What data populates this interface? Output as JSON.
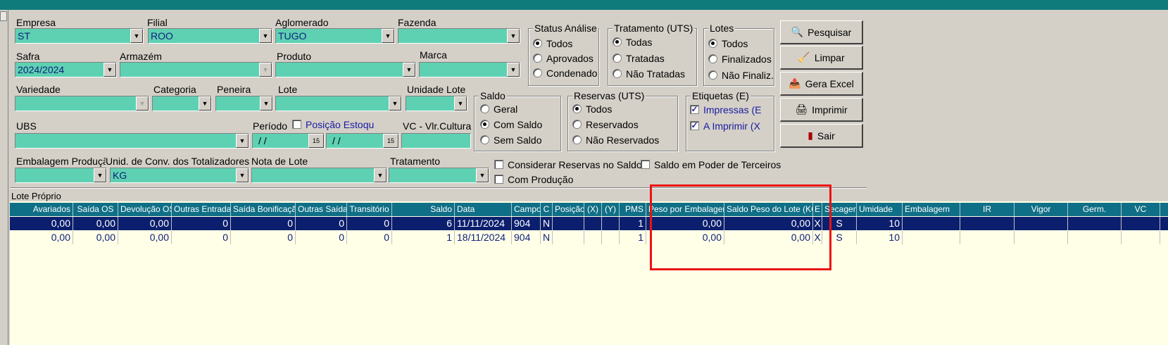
{
  "filters": {
    "empresa": {
      "label": "Empresa",
      "value": "ST"
    },
    "filial": {
      "label": "Filial",
      "value": "ROO"
    },
    "aglomerado": {
      "label": "Aglomerado",
      "value": "TUGO"
    },
    "fazenda": {
      "label": "Fazenda",
      "value": ""
    },
    "safra": {
      "label": "Safra",
      "value": "2024/2024"
    },
    "armazem": {
      "label": "Armazém",
      "value": ""
    },
    "produto": {
      "label": "Produto",
      "value": ""
    },
    "marca": {
      "label": "Marca",
      "value": ""
    },
    "variedade": {
      "label": "Variedade",
      "value": ""
    },
    "categoria": {
      "label": "Categoria",
      "value": ""
    },
    "peneira": {
      "label": "Peneira",
      "value": ""
    },
    "lote": {
      "label": "Lote",
      "value": ""
    },
    "unidade_lote": {
      "label": "Unidade Lote",
      "value": ""
    },
    "ubs": {
      "label": "UBS",
      "value": ""
    },
    "periodo": {
      "label": "Período",
      "from": " / /",
      "to": " / /"
    },
    "posicao_estoque": {
      "label": "Posição Estoqu"
    },
    "vc": {
      "label": "VC - Vlr.Cultura",
      "value": ""
    },
    "embalagem_producao": {
      "label": "Embalagem Produção",
      "value": ""
    },
    "unid_conv": {
      "label": "Unid. de Conv. dos Totalizadores",
      "value": "KG"
    },
    "nota_lote": {
      "label": "Nota de Lote",
      "value": ""
    },
    "tratamento": {
      "label": "Tratamento",
      "value": ""
    },
    "considerar_reservas": {
      "label": "Considerar Reservas no Saldo"
    },
    "saldo_terceiros": {
      "label": "Saldo em Poder de Terceiros"
    },
    "com_producao": {
      "label": "Com Produção"
    }
  },
  "groups": {
    "status_analise": {
      "title": "Status Análise",
      "options": [
        "Todos",
        "Aprovados",
        "Condenado"
      ]
    },
    "tratamento_uts": {
      "title": "Tratamento (UTS)",
      "options": [
        "Todas",
        "Tratadas",
        "Não Tratadas"
      ]
    },
    "lotes": {
      "title": "Lotes",
      "options": [
        "Todos",
        "Finalizados",
        "Não Finaliz."
      ]
    },
    "saldo": {
      "title": "Saldo",
      "options": [
        "Geral",
        "Com Saldo",
        "Sem Saldo"
      ]
    },
    "reservas_uts": {
      "title": "Reservas (UTS)",
      "options": [
        "Todos",
        "Reservados",
        "Não Reservados"
      ]
    },
    "etiquetas": {
      "title": "Etiquetas (E)",
      "options": [
        "Impressas (E",
        "A Imprimir (X"
      ]
    }
  },
  "buttons": {
    "pesquisar": "Pesquisar",
    "limpar": "Limpar",
    "gera_excel": "Gera Excel",
    "imprimir": "Imprimir",
    "sair": "Sair"
  },
  "section_label": "Lote Próprio",
  "grid": {
    "columns": [
      "Avariados",
      "Saída OS",
      "Devolução OS",
      "Outras Entradas",
      "Saída Bonificação",
      "Outras Saídas",
      "Transitório",
      "Saldo",
      "Data",
      "Campo",
      "C",
      "Posição",
      "(X)",
      "(Y)",
      "PMS",
      "Peso por Embalagem",
      "Saldo Peso do Lote (KG)",
      "E",
      "Secagem",
      "Umidade",
      "Embalagem",
      "IR",
      "Vigor",
      "Germ.",
      "VC"
    ],
    "rows": [
      [
        "0,00",
        "0,00",
        "0,00",
        "0",
        "0",
        "0",
        "0",
        "6",
        "11/11/2024",
        "904",
        "N",
        "",
        "",
        "",
        "1",
        "0,00",
        "0,00",
        "X",
        "S",
        "10",
        "",
        "",
        "",
        "",
        ""
      ],
      [
        "0,00",
        "0,00",
        "0,00",
        "0",
        "0",
        "0",
        "0",
        "1",
        "18/11/2024",
        "904",
        "N",
        "",
        "",
        "",
        "1",
        "0,00",
        "0,00",
        "X",
        "S",
        "10",
        "",
        "",
        "",
        "",
        ""
      ]
    ]
  },
  "colors": {
    "field_bg": "#5ed1b3",
    "header_bg": "#0f6f86",
    "selected_row": "#0c1f6e",
    "highlight": "#ee1111"
  }
}
